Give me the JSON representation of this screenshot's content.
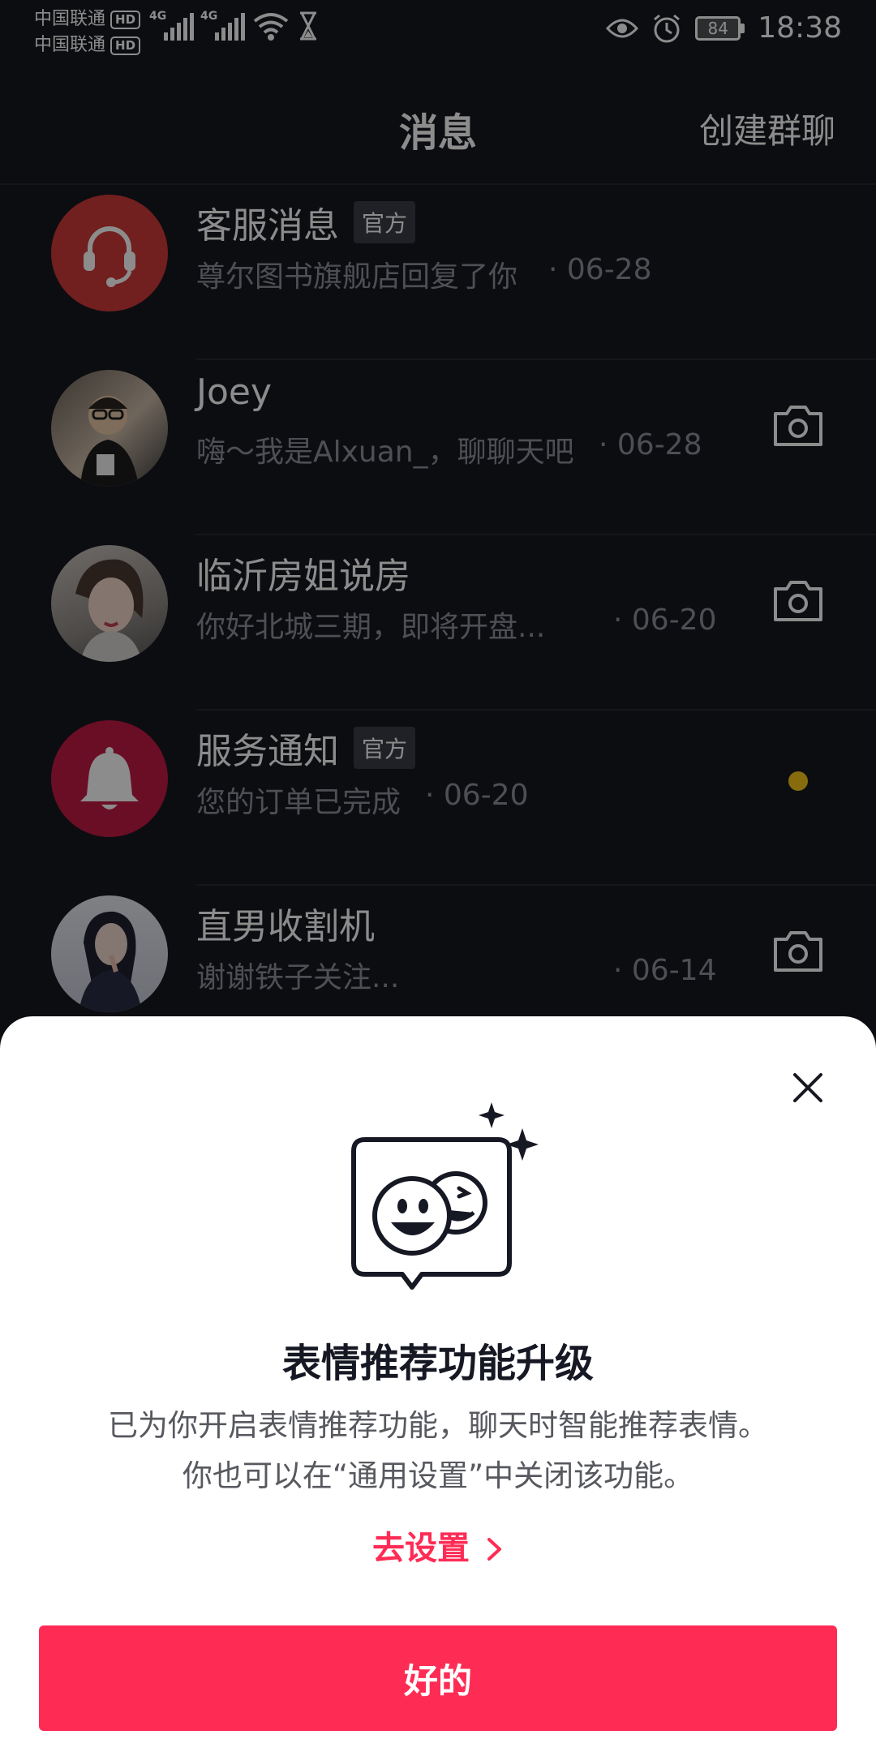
{
  "status_bar": {
    "carrier1": "中国联通",
    "carrier2": "中国联通",
    "hd": "HD",
    "network": "4G",
    "battery": "84",
    "time": "18:38"
  },
  "header": {
    "title": "消息",
    "create_group": "创建群聊"
  },
  "messages": [
    {
      "name": "客服消息",
      "badge": "官方",
      "preview": "尊尔图书旗舰店回复了你",
      "date": "· 06-28",
      "avatar_icon": "headset-icon",
      "avatar_color": "#d03a3a",
      "action": "none"
    },
    {
      "name": "Joey",
      "badge": "",
      "preview": "嗨～我是Alxuan_，聊聊天吧",
      "date": "· 06-28",
      "avatar_icon": "user-photo",
      "action": "camera-icon"
    },
    {
      "name": "临沂房姐说房",
      "badge": "",
      "preview": "你好北城三期，即将开盘...",
      "date": "· 06-20",
      "avatar_icon": "user-photo",
      "action": "camera-icon"
    },
    {
      "name": "服务通知",
      "badge": "官方",
      "preview": "您的订单已完成",
      "date": "· 06-20",
      "avatar_icon": "bell-icon",
      "avatar_color": "#c21a45",
      "action": "unread-dot",
      "dot_color": "#f5c518"
    },
    {
      "name": "直男收割机",
      "badge": "",
      "preview": "谢谢铁子关注...",
      "date": "· 06-14",
      "avatar_icon": "user-photo",
      "action": "camera-icon"
    }
  ],
  "sheet": {
    "close_icon": "close-icon",
    "illustration": "emoji-chat-bubble-icon",
    "heading": "表情推荐功能升级",
    "desc_line1": "已为你开启表情推荐功能，聊天时智能推荐表情。",
    "desc_line2": "你也可以在“通用设置”中关闭该功能。",
    "go_settings": "去设置",
    "ok_button": "好的",
    "accent_color": "#fe2c55"
  }
}
